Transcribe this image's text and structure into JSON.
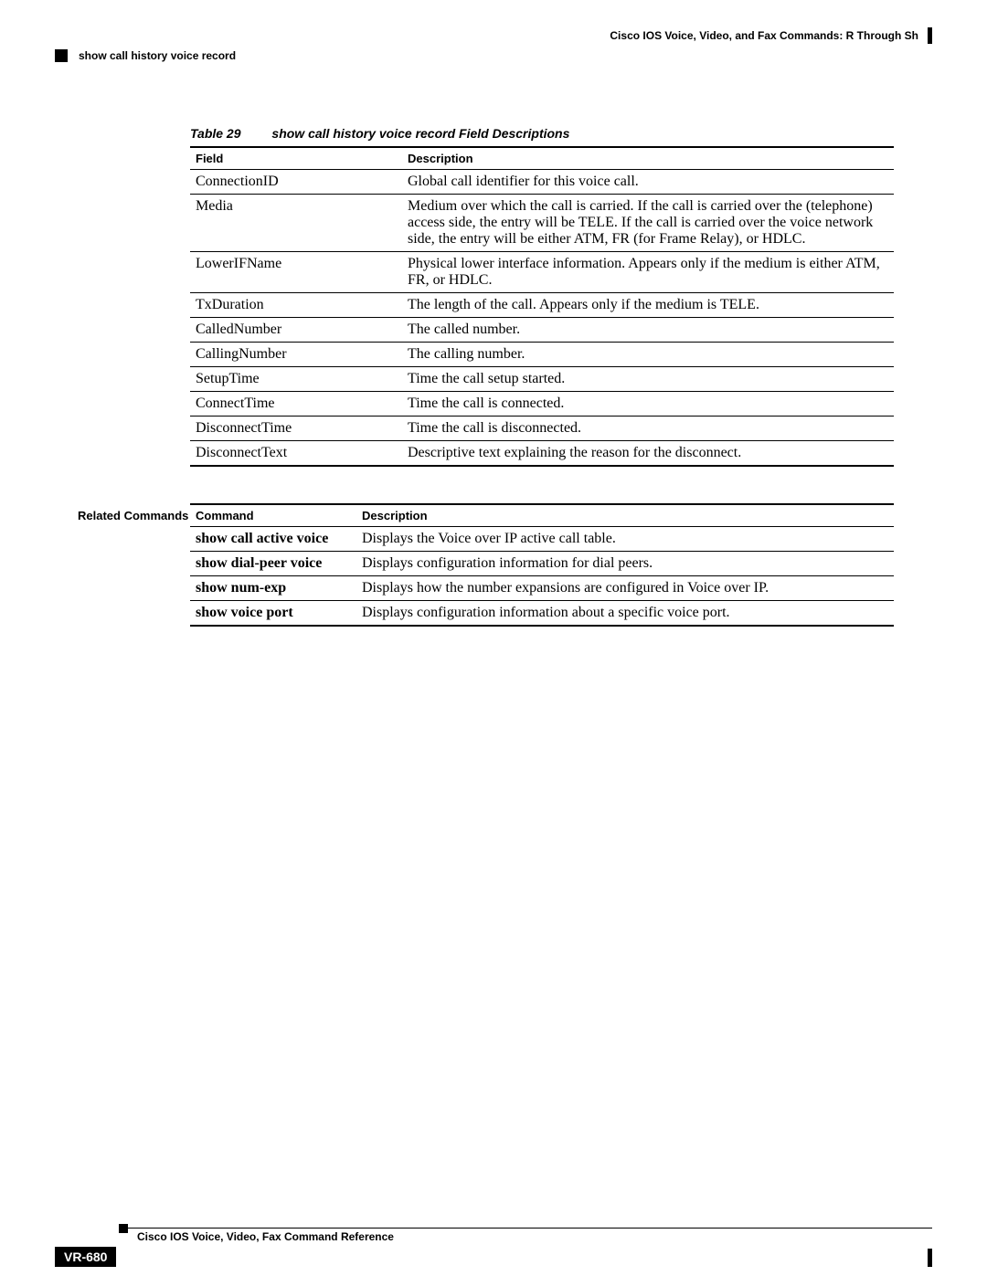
{
  "header": {
    "chapter": "Cisco IOS Voice, Video, and Fax Commands: R Through Sh",
    "section": "show call history voice record"
  },
  "fields_table": {
    "number": "Table 29",
    "title": "show call history voice record Field Descriptions",
    "headers": [
      "Field",
      "Description"
    ],
    "rows": [
      {
        "field": "ConnectionID",
        "description": "Global call identifier for this voice call."
      },
      {
        "field": "Media",
        "description": "Medium over which the call is carried. If the call is carried over the (telephone) access side, the entry will be TELE. If the call is carried over the voice network side, the entry will be either ATM, FR (for Frame Relay), or HDLC."
      },
      {
        "field": "LowerIFName",
        "description": "Physical lower interface information. Appears only if the medium is either ATM, FR, or HDLC."
      },
      {
        "field": "TxDuration",
        "description": "The length of the call. Appears only if the medium is TELE."
      },
      {
        "field": "CalledNumber",
        "description": "The called number."
      },
      {
        "field": "CallingNumber",
        "description": "The calling number."
      },
      {
        "field": "SetupTime",
        "description": "Time the call setup started."
      },
      {
        "field": "ConnectTime",
        "description": "Time the call is connected."
      },
      {
        "field": "DisconnectTime",
        "description": "Time the call is disconnected."
      },
      {
        "field": "DisconnectText",
        "description": "Descriptive text explaining the reason for the disconnect."
      }
    ]
  },
  "commands_table": {
    "side_label": "Related Commands",
    "headers": [
      "Command",
      "Description"
    ],
    "rows": [
      {
        "command": "show call active voice",
        "description": "Displays the Voice over IP active call table."
      },
      {
        "command": "show dial-peer voice",
        "description": "Displays configuration information for dial peers."
      },
      {
        "command": "show num-exp",
        "description": "Displays how the number expansions are configured in Voice over IP."
      },
      {
        "command": "show voice port",
        "description": "Displays configuration information about a specific voice port."
      }
    ]
  },
  "footer": {
    "book_title": "Cisco IOS Voice, Video, Fax Command Reference",
    "page_number": "VR-680"
  }
}
